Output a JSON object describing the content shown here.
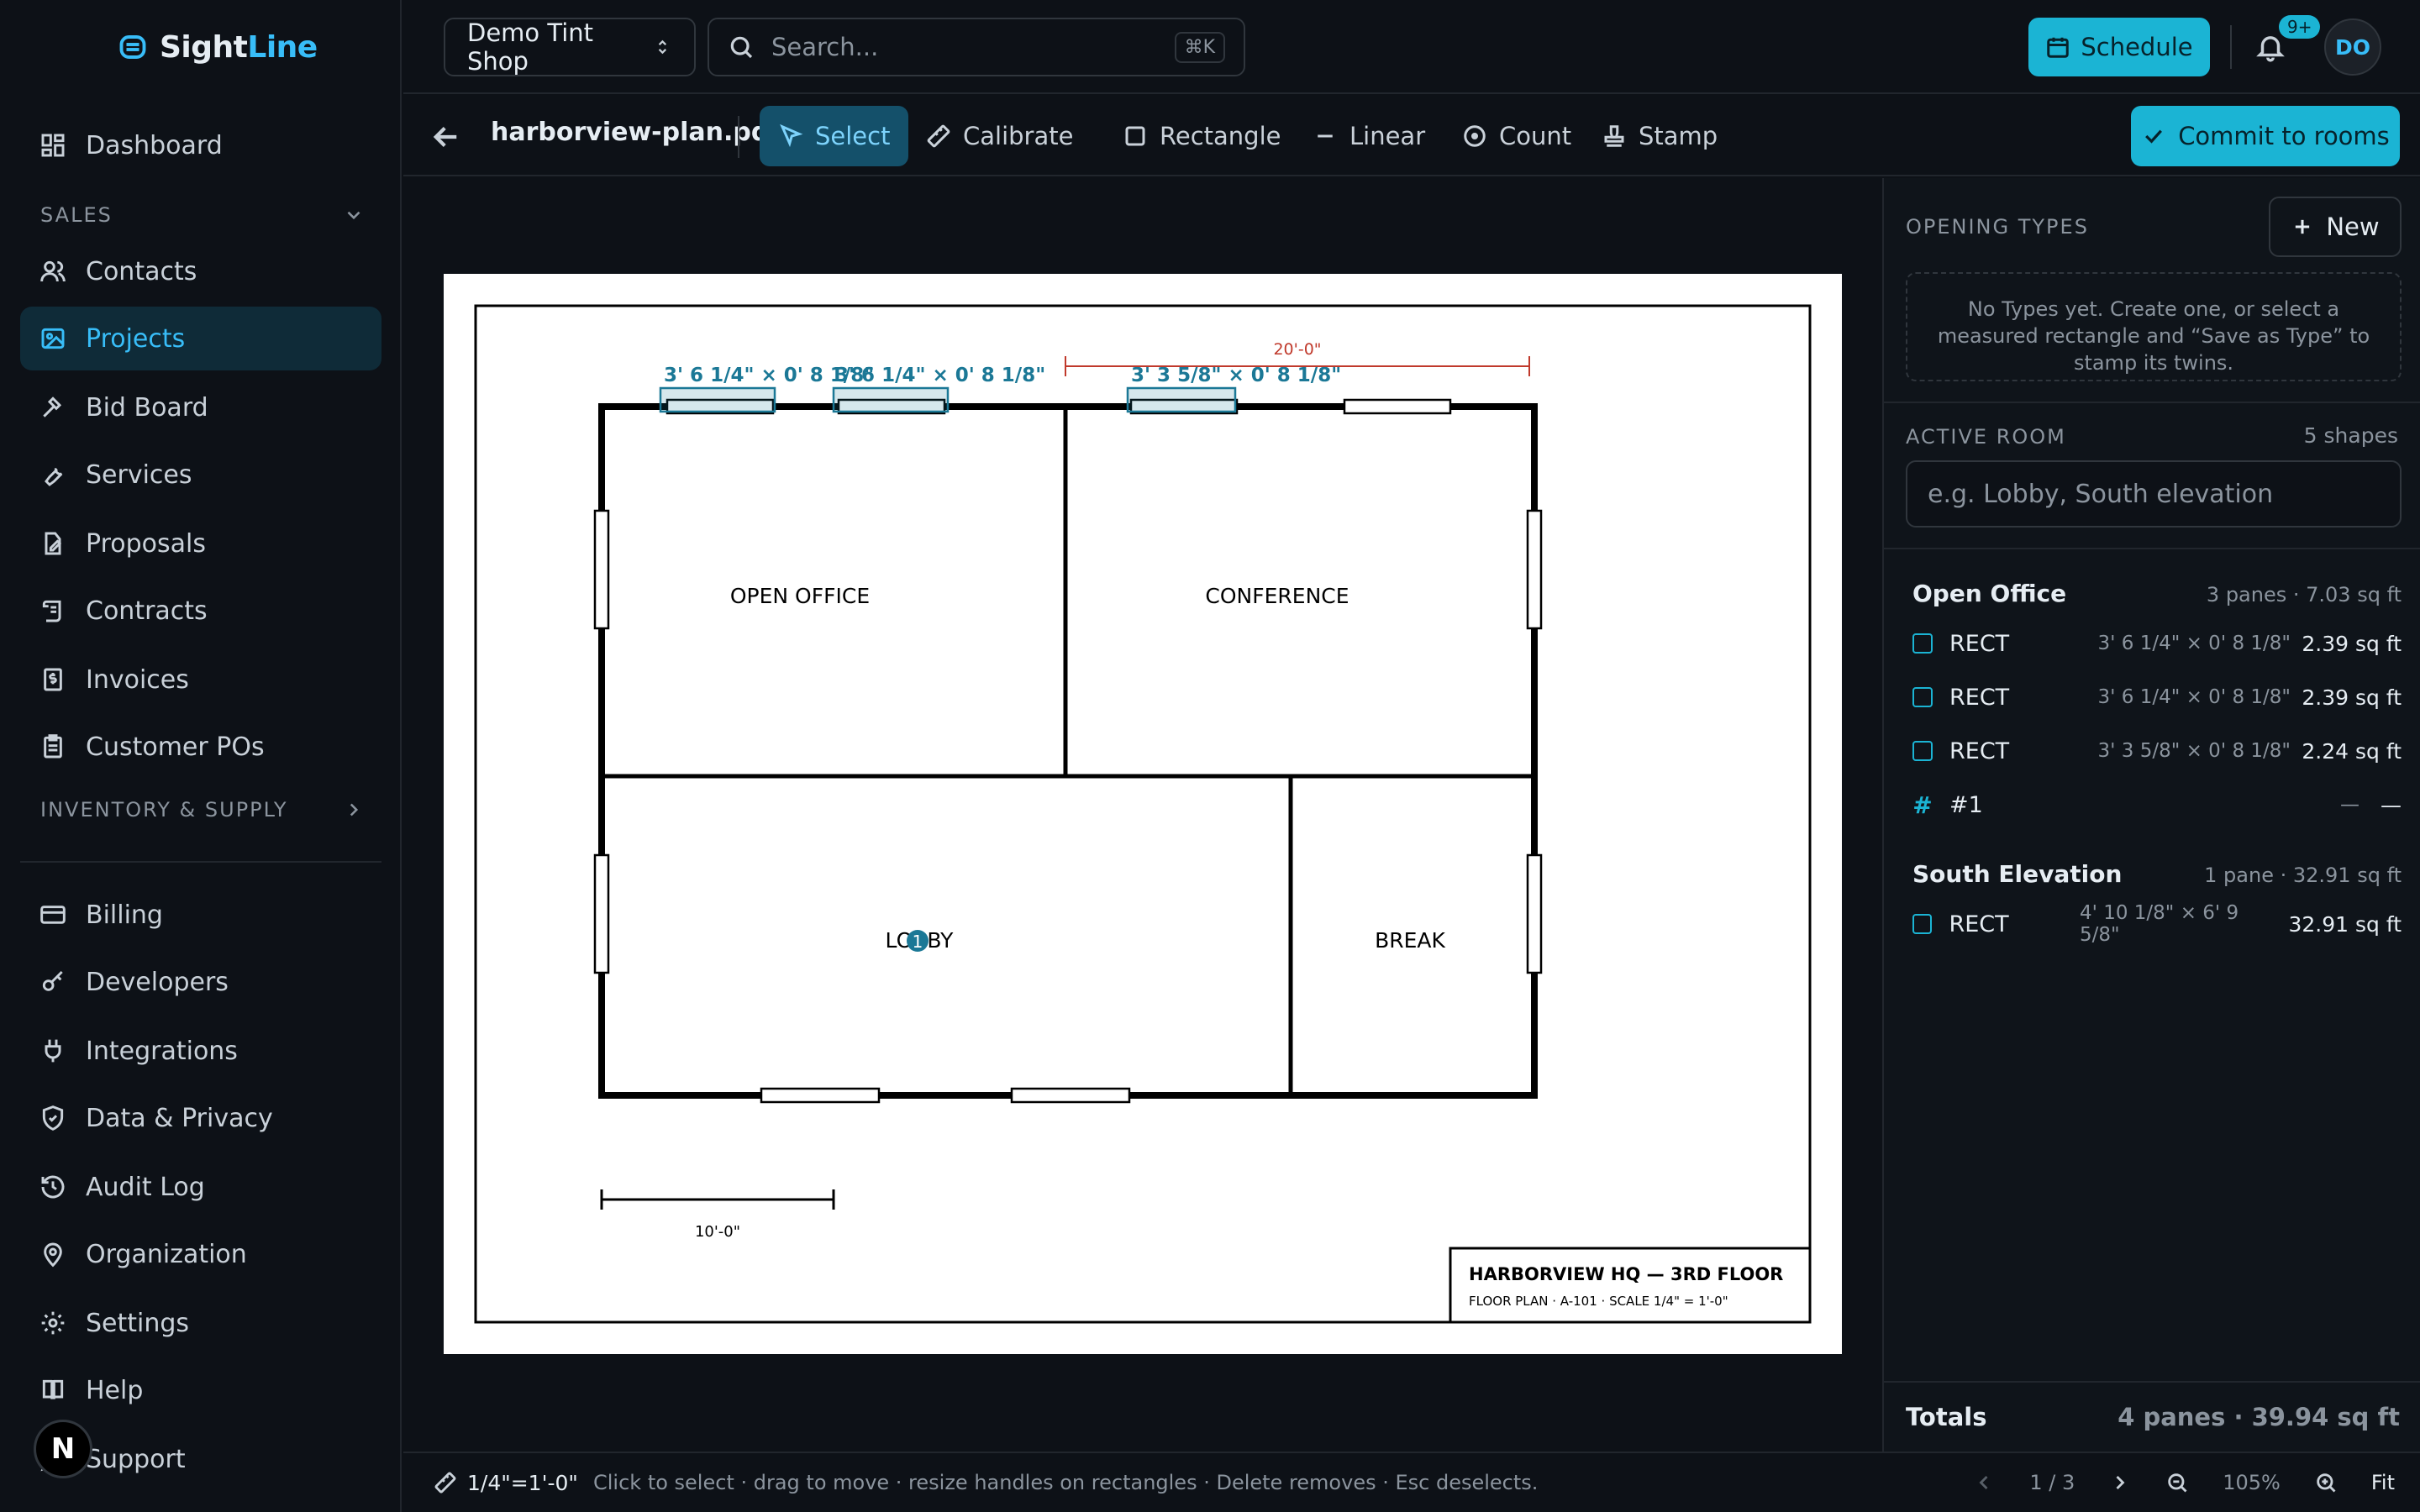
{
  "brand": {
    "part1": "Sight",
    "part2": "Line",
    "accent": "#38bdf8"
  },
  "sidebar": {
    "top": [
      {
        "label": "Dashboard",
        "icon": "dashboard-icon"
      }
    ],
    "sales_label": "SALES",
    "sales": [
      {
        "label": "Contacts",
        "icon": "users-icon"
      },
      {
        "label": "Projects",
        "icon": "image-icon",
        "active": true
      },
      {
        "label": "Bid Board",
        "icon": "hammer-icon"
      },
      {
        "label": "Services",
        "icon": "wrench-icon"
      },
      {
        "label": "Proposals",
        "icon": "edit-doc-icon"
      },
      {
        "label": "Contracts",
        "icon": "scroll-icon"
      },
      {
        "label": "Invoices",
        "icon": "dollar-doc-icon"
      },
      {
        "label": "Customer POs",
        "icon": "clipboard-icon"
      }
    ],
    "inventory_label": "INVENTORY & SUPPLY",
    "bottom": [
      {
        "label": "Billing",
        "icon": "card-icon"
      },
      {
        "label": "Developers",
        "icon": "key-icon"
      },
      {
        "label": "Integrations",
        "icon": "plug-icon"
      },
      {
        "label": "Data & Privacy",
        "icon": "shield-icon"
      },
      {
        "label": "Audit Log",
        "icon": "history-icon"
      },
      {
        "label": "Organization",
        "icon": "pin-icon"
      },
      {
        "label": "Settings",
        "icon": "gear-icon"
      },
      {
        "label": "Help",
        "icon": "book-icon"
      },
      {
        "label": "Support",
        "icon": "chat-icon"
      }
    ],
    "fab_label": "N"
  },
  "topbar": {
    "shop": "Demo Tint Shop",
    "search_placeholder": "Search...",
    "search_kbd": "⌘K",
    "schedule": "Schedule",
    "notif_badge": "9+",
    "avatar": "DO"
  },
  "toolbar": {
    "filename": "harborview-plan.pdf",
    "tools": [
      "Select",
      "Calibrate",
      "Rectangle",
      "Linear",
      "Count",
      "Stamp"
    ],
    "commit": "Commit to rooms"
  },
  "plan": {
    "rooms": [
      "OPEN OFFICE",
      "CONFERENCE",
      "LOBBY",
      "BREAK"
    ],
    "dim_labels": [
      "3' 6 1/4\" × 0' 8 1/8\"",
      "3' 6 1/4\" × 0' 8 1/8\"",
      "3' 3 5/8\" × 0' 8 1/8\""
    ],
    "linear_label": "20'-0\"",
    "scale_bar_label": "10'-0\"",
    "count_marker": "1",
    "title": "HARBORVIEW HQ — 3RD FLOOR",
    "subtitle": "FLOOR PLAN · A-101 · SCALE 1/4\" = 1'-0\""
  },
  "panel": {
    "opening_types_label": "OPENING TYPES",
    "new_label": "New",
    "empty_text": "No Types yet. Create one, or select a measured rectangle and “Save as Type” to stamp its twins.",
    "active_room_label": "ACTIVE ROOM",
    "shape_count": "5 shapes",
    "room_placeholder": "e.g. Lobby, South elevation",
    "groups": [
      {
        "name": "Open Office",
        "summary": "3 panes · 7.03 sq ft",
        "rows": [
          {
            "kind": "RECT",
            "dims": "3' 6 1/4\" × 0' 8 1/8\"",
            "area": "2.39 sq ft",
            "type": "rect"
          },
          {
            "kind": "RECT",
            "dims": "3' 6 1/4\" × 0' 8 1/8\"",
            "area": "2.39 sq ft",
            "type": "rect"
          },
          {
            "kind": "RECT",
            "dims": "3' 3 5/8\" × 0' 8 1/8\"",
            "area": "2.24 sq ft",
            "type": "rect"
          },
          {
            "kind": "#1",
            "dims": "—",
            "area": "—",
            "type": "count"
          }
        ]
      },
      {
        "name": "South Elevation",
        "summary": "1 pane · 32.91 sq ft",
        "rows": [
          {
            "kind": "RECT",
            "dims": "4' 10 1/8\" × 6' 9 5/8\"",
            "area": "32.91 sq ft",
            "type": "rect"
          }
        ]
      }
    ],
    "totals_label": "Totals",
    "totals_value": "4 panes · 39.94 sq ft"
  },
  "status": {
    "scale": "1/4\"=1'-0\"",
    "hint": "Click to select · drag to move · resize handles on rectangles · Delete removes · Esc deselects.",
    "page": "1 / 3",
    "zoom": "105%",
    "fit": "Fit"
  }
}
